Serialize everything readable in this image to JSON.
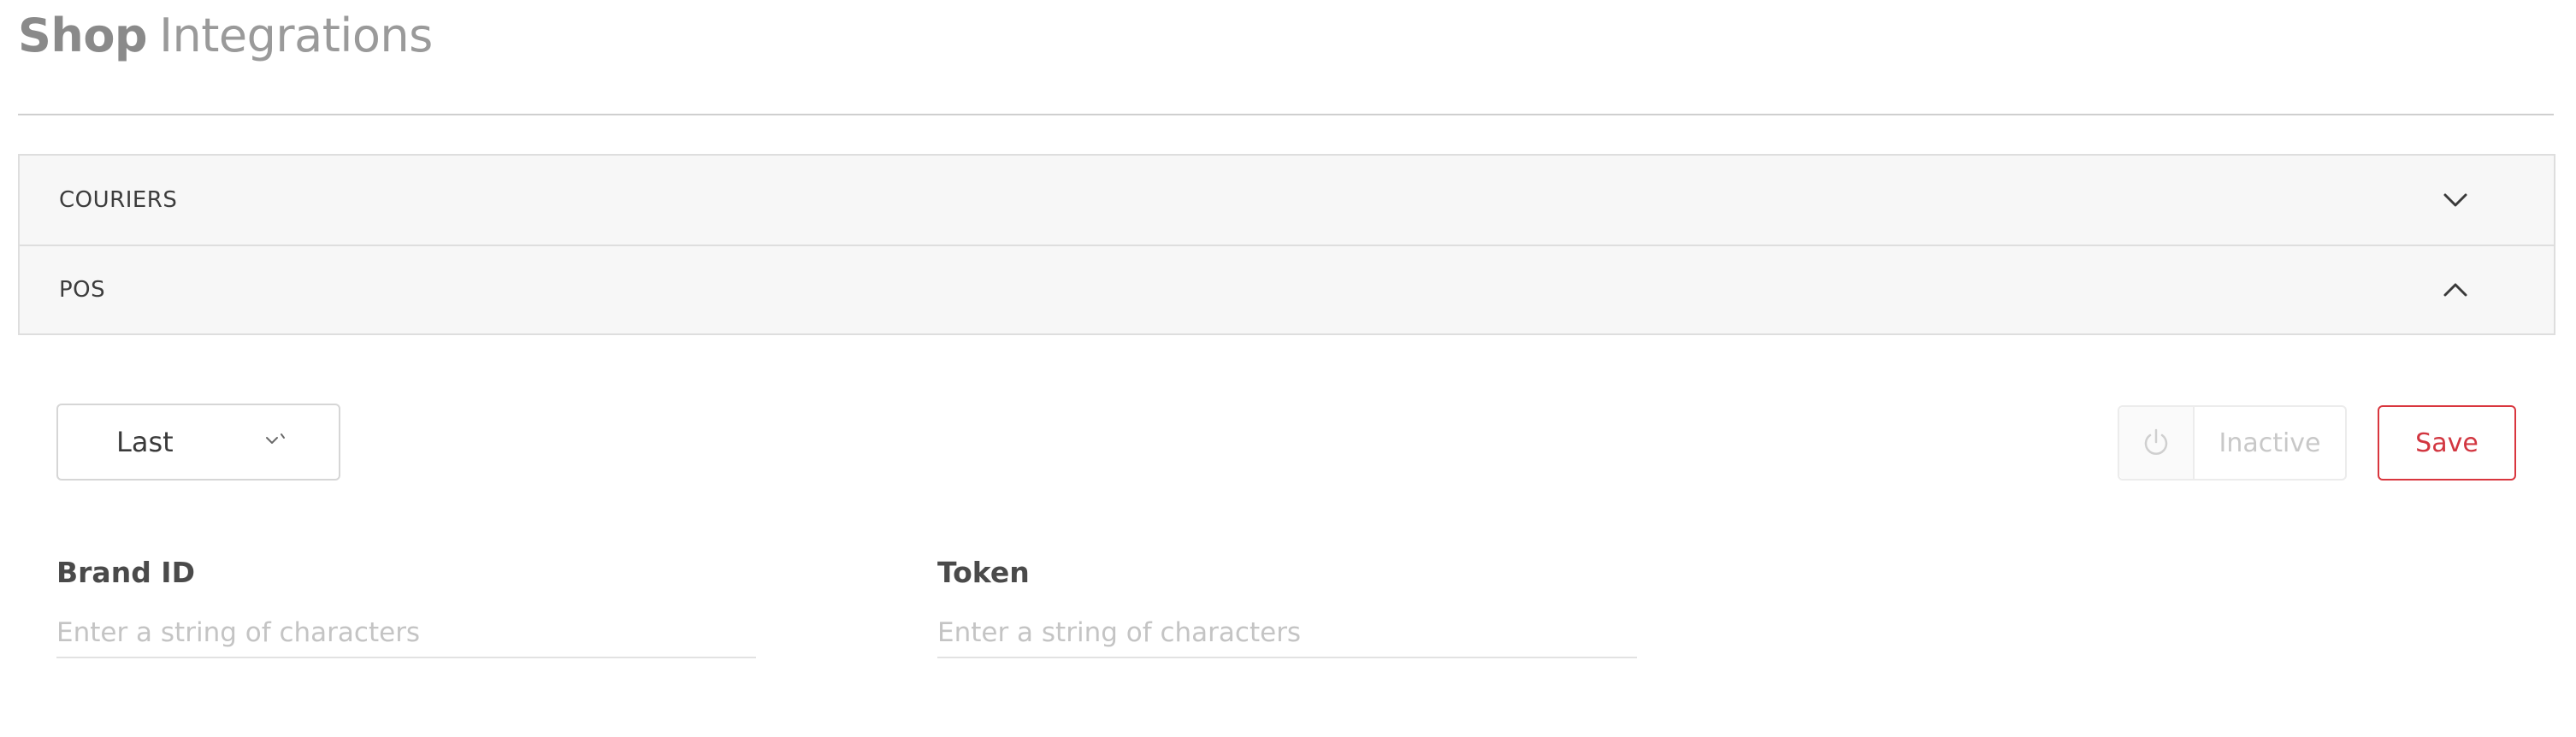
{
  "header": {
    "title_bold": "Shop",
    "title_light": "Integrations"
  },
  "accordion": {
    "sections": [
      {
        "label": "COURIERS",
        "expanded": false,
        "icon": "chevron-down-icon"
      },
      {
        "label": "POS",
        "expanded": true,
        "icon": "chevron-up-icon"
      }
    ]
  },
  "pos": {
    "provider_select": {
      "value": "Last",
      "icon": "chevron-down-icon"
    },
    "status_toggle": {
      "label": "Inactive",
      "icon": "power-icon"
    },
    "save_label": "Save",
    "fields": {
      "brand_id": {
        "label": "Brand ID",
        "value": "",
        "placeholder": "Enter a string of characters"
      },
      "token": {
        "label": "Token",
        "value": "",
        "placeholder": "Enter a string of characters"
      }
    }
  },
  "colors": {
    "accent_red": "#d9363e",
    "panel_bg": "#f7f7f7",
    "border": "#dedede"
  }
}
